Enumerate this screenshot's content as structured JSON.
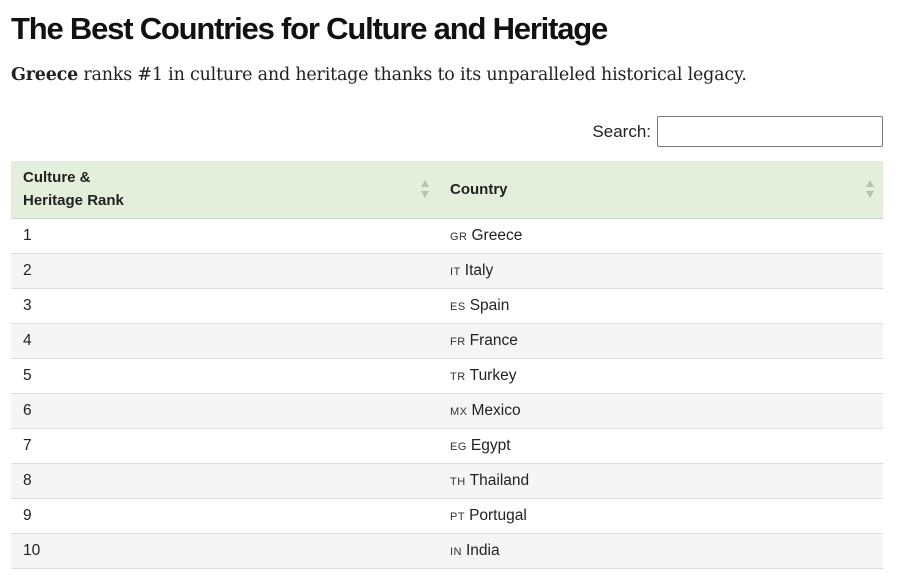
{
  "header": {
    "title": "The Best Countries for Culture and Heritage",
    "subtitle_bold": "Greece",
    "subtitle_rest": " ranks #1 in culture and heritage thanks to its unparalleled historical legacy."
  },
  "search": {
    "label": "Search:",
    "value": "",
    "placeholder": ""
  },
  "table": {
    "columns": [
      {
        "line1": "Culture &",
        "line2": "Heritage Rank"
      },
      {
        "label": "Country"
      }
    ],
    "rows": [
      {
        "rank": "1",
        "code": "GR",
        "country": "Greece"
      },
      {
        "rank": "2",
        "code": "IT",
        "country": "Italy"
      },
      {
        "rank": "3",
        "code": "ES",
        "country": "Spain"
      },
      {
        "rank": "4",
        "code": "FR",
        "country": "France"
      },
      {
        "rank": "5",
        "code": "TR",
        "country": "Turkey"
      },
      {
        "rank": "6",
        "code": "MX",
        "country": "Mexico"
      },
      {
        "rank": "7",
        "code": "EG",
        "country": "Egypt"
      },
      {
        "rank": "8",
        "code": "TH",
        "country": "Thailand"
      },
      {
        "rank": "9",
        "code": "PT",
        "country": "Portugal"
      },
      {
        "rank": "10",
        "code": "IN",
        "country": "India"
      }
    ]
  },
  "colors": {
    "header_bg": "#e3efdb",
    "row_alt_bg": "#f5f5f5",
    "sort_arrow": "#b5c4ad"
  },
  "icons": {
    "sort": "sort-arrows-icon"
  }
}
